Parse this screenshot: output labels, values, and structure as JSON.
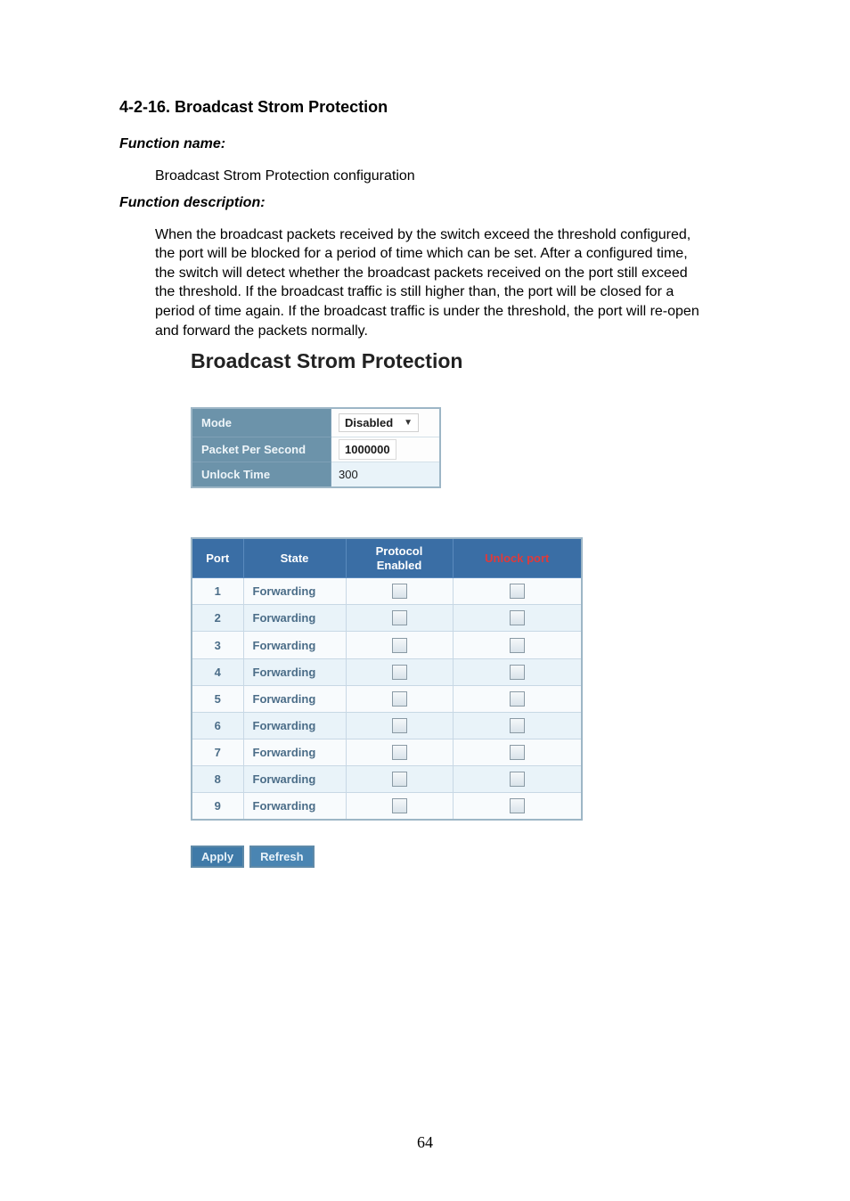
{
  "doc": {
    "section_heading": "4-2-16. Broadcast Strom Protection",
    "function_name_label": "Function name:",
    "function_name_value": "Broadcast Strom Protection configuration",
    "function_description_label": "Function description:",
    "function_description_value": "When the broadcast packets received by the switch exceed the threshold configured, the port will be blocked for a period of time which can be set. After a configured time, the switch will detect whether the broadcast packets received on the port still exceed the threshold. If the broadcast traffic is still higher than, the port will be closed for a period of time again. If the broadcast traffic is under the threshold, the port will re-open and forward the packets normally.",
    "page_number": "64"
  },
  "panel": {
    "title": "Broadcast Strom Protection",
    "settings": {
      "mode_label": "Mode",
      "mode_value": "Disabled",
      "pps_label": "Packet Per Second",
      "pps_value": "1000000",
      "unlock_time_label": "Unlock Time",
      "unlock_time_value": "300"
    },
    "columns": {
      "port": "Port",
      "state": "State",
      "protocol_enabled": "Protocol Enabled",
      "unlock_port": "Unlock port"
    },
    "rows": [
      {
        "port": "1",
        "state": "Forwarding",
        "protocol_enabled": false,
        "unlock_port": false
      },
      {
        "port": "2",
        "state": "Forwarding",
        "protocol_enabled": false,
        "unlock_port": false
      },
      {
        "port": "3",
        "state": "Forwarding",
        "protocol_enabled": false,
        "unlock_port": false
      },
      {
        "port": "4",
        "state": "Forwarding",
        "protocol_enabled": false,
        "unlock_port": false
      },
      {
        "port": "5",
        "state": "Forwarding",
        "protocol_enabled": false,
        "unlock_port": false
      },
      {
        "port": "6",
        "state": "Forwarding",
        "protocol_enabled": false,
        "unlock_port": false
      },
      {
        "port": "7",
        "state": "Forwarding",
        "protocol_enabled": false,
        "unlock_port": false
      },
      {
        "port": "8",
        "state": "Forwarding",
        "protocol_enabled": false,
        "unlock_port": false
      },
      {
        "port": "9",
        "state": "Forwarding",
        "protocol_enabled": false,
        "unlock_port": false
      }
    ],
    "buttons": {
      "apply": "Apply",
      "refresh": "Refresh"
    }
  }
}
